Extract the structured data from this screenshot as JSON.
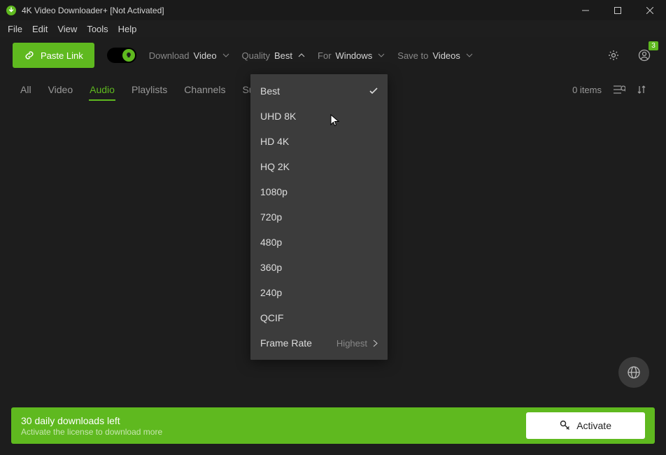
{
  "title": "4K Video Downloader+ [Not Activated]",
  "menu": [
    "File",
    "Edit",
    "View",
    "Tools",
    "Help"
  ],
  "paste_label": "Paste Link",
  "opts": {
    "download": {
      "label": "Download",
      "value": "Video"
    },
    "quality": {
      "label": "Quality",
      "value": "Best"
    },
    "for": {
      "label": "For",
      "value": "Windows"
    },
    "saveto": {
      "label": "Save to",
      "value": "Videos"
    }
  },
  "notif_count": "3",
  "tabs": [
    "All",
    "Video",
    "Audio",
    "Playlists",
    "Channels",
    "Subscriptions"
  ],
  "tabs_active_index": 2,
  "items_count": "0 items",
  "dropdown": {
    "items": [
      "Best",
      "UHD 8K",
      "HD 4K",
      "HQ 2K",
      "1080p",
      "720p",
      "480p",
      "360p",
      "240p",
      "QCIF"
    ],
    "selected_index": 0,
    "fr_label": "Frame Rate",
    "fr_value": "Highest"
  },
  "banner": {
    "title": "30 daily downloads left",
    "sub": "Activate the license to download more",
    "btn": "Activate"
  }
}
